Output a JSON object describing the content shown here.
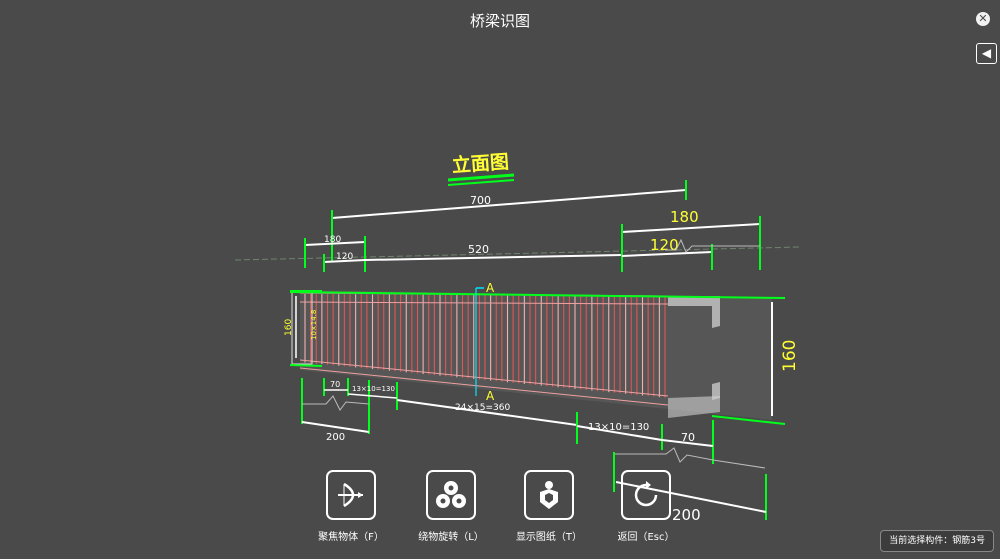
{
  "window": {
    "title": "桥梁识图"
  },
  "drawing": {
    "view_title": "立面图",
    "section_mark": "A",
    "dims": {
      "top_total": "700",
      "top_left_outer": "180",
      "top_left_inner": "120",
      "top_middle": "520",
      "top_right_outer": "180",
      "top_right_inner": "120",
      "height_left": "160",
      "left_small": "10×14.8",
      "height_right": "160",
      "bottom_left_70": "70",
      "bottom_left_13": "13×10=130",
      "bottom_mid": "24×15=360",
      "bottom_left_200": "200",
      "bottom_right_13": "13×10=130",
      "bottom_right_70": "70",
      "bottom_right_200": "200"
    }
  },
  "toolbar": {
    "items": [
      {
        "label": "聚焦物体（F）",
        "icon": "bow-arrow-icon"
      },
      {
        "label": "绕物旋转（L）",
        "icon": "circles-icon"
      },
      {
        "label": "显示图纸（T）",
        "icon": "hand-shape-icon"
      },
      {
        "label": "返回（Esc）",
        "icon": "rotate-back-icon"
      }
    ]
  },
  "status": {
    "text": "当前选择构件：钢筋3号"
  },
  "colors": {
    "accent": "#00ff1a",
    "dim_text": "#ffff33",
    "rebar": "#e05555"
  }
}
